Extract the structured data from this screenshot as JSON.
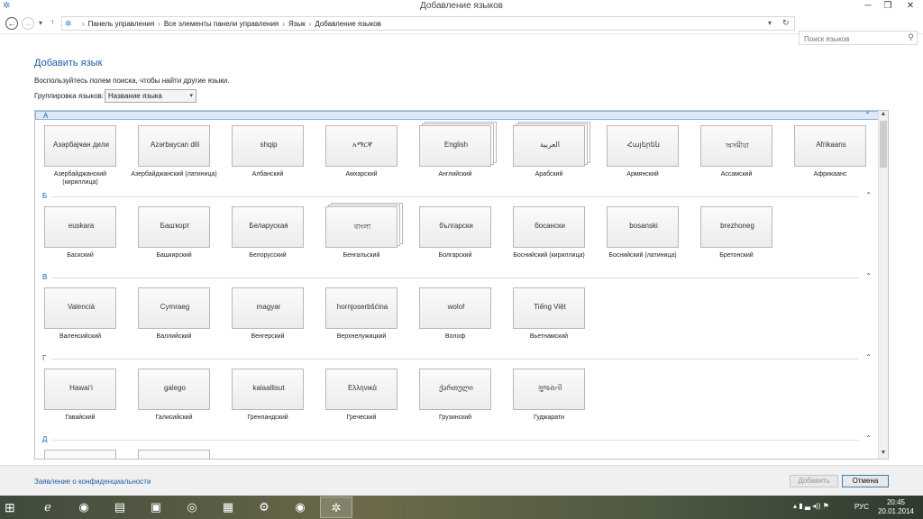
{
  "window": {
    "title": "Добавление языков"
  },
  "nav": {
    "crumbs": [
      "Панель управления",
      "Все элементы панели управления",
      "Язык",
      "Добавление языков"
    ],
    "search_placeholder": "Поиск языков"
  },
  "main": {
    "heading": "Добавить язык",
    "hint": "Воспользуйтесь полем поиска, чтобы найти другие языки.",
    "group_label": "Группировка языков:",
    "group_value": "Название языка"
  },
  "groups": [
    {
      "letter": "А",
      "items": [
        {
          "name": "Азәрбајҹан дили",
          "label": "Азербайджанский (кириллица)"
        },
        {
          "name": "Azərbaycan dili",
          "label": "Азербайджанский (латиница)"
        },
        {
          "name": "shqip",
          "label": "Албанский"
        },
        {
          "name": "አማርኛ",
          "label": "Амхарский"
        },
        {
          "name": "English",
          "label": "Английский",
          "stack": true
        },
        {
          "name": "العربية",
          "label": "Арабский",
          "stack": true
        },
        {
          "name": "Հայերեն",
          "label": "Армянский"
        },
        {
          "name": "অসমীয়া",
          "label": "Ассамский"
        },
        {
          "name": "Afrikaans",
          "label": "Африкаанс"
        }
      ]
    },
    {
      "letter": "Б",
      "items": [
        {
          "name": "euskara",
          "label": "Баскский"
        },
        {
          "name": "Башҡорт",
          "label": "Башкирский"
        },
        {
          "name": "Беларуская",
          "label": "Белорусский"
        },
        {
          "name": "বাংলা",
          "label": "Бенгальский",
          "stack": true
        },
        {
          "name": "български",
          "label": "Болгарский"
        },
        {
          "name": "босански",
          "label": "Боснийский (кириллица)"
        },
        {
          "name": "bosanski",
          "label": "Боснийский (латиница)"
        },
        {
          "name": "brezhoneg",
          "label": "Бретонский"
        }
      ]
    },
    {
      "letter": "В",
      "items": [
        {
          "name": "Valencià",
          "label": "Валенсийский"
        },
        {
          "name": "Cymraeg",
          "label": "Валлийский"
        },
        {
          "name": "magyar",
          "label": "Венгерский"
        },
        {
          "name": "hornjoserbšćina",
          "label": "Верхнелужицкий"
        },
        {
          "name": "wolof",
          "label": "Волоф"
        },
        {
          "name": "Tiếng Việt",
          "label": "Вьетнамский"
        }
      ]
    },
    {
      "letter": "Г",
      "items": [
        {
          "name": "Hawaiʻi",
          "label": "Гавайский"
        },
        {
          "name": "galego",
          "label": "Галисийский"
        },
        {
          "name": "kalaallisut",
          "label": "Гренландский"
        },
        {
          "name": "Ελληνικά",
          "label": "Греческий"
        },
        {
          "name": "ქართული",
          "label": "Грузинский"
        },
        {
          "name": "ગુજરાતી",
          "label": "Гуджарати"
        }
      ]
    },
    {
      "letter": "Д",
      "items": [
        {
          "name": "",
          "label": ""
        },
        {
          "name": "",
          "label": ""
        }
      ]
    }
  ],
  "footer": {
    "privacy": "Заявление о конфиденциальности",
    "add": "Добавить",
    "cancel": "Отмена"
  },
  "taskbar": {
    "lang": "РУС",
    "time": "20:45",
    "date": "20.01.2014"
  },
  "colors": {
    "accent": "#1e5ba8",
    "selection": "#dde9f7"
  }
}
